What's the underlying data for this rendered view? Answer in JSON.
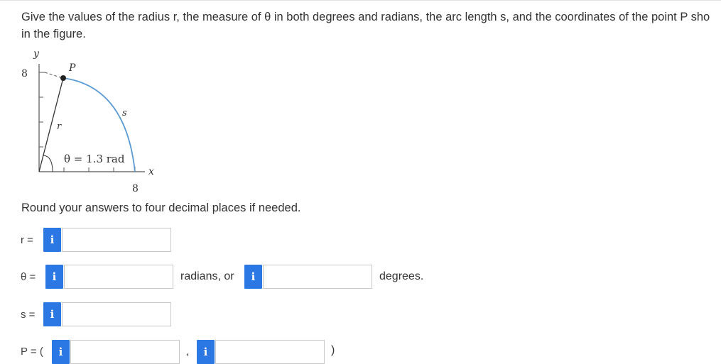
{
  "question": {
    "line1": "Give the values of the radius r, the measure of θ in both degrees and radians, the arc length s, and the coordinates of the point P sho",
    "line2": "in the figure."
  },
  "figure": {
    "y_axis_label": "y",
    "x_axis_label": "x",
    "y_tick_value": "8",
    "x_tick_value": "8",
    "point_label": "P",
    "radius_label": "r",
    "arc_label": "s",
    "angle_label": "θ = 1.3 rad"
  },
  "instruction": "Round your answers to four decimal places if needed.",
  "answers": {
    "r": {
      "label": "r =",
      "value": ""
    },
    "theta": {
      "label": "θ =",
      "radians_value": "",
      "radians_suffix": "radians, or",
      "degrees_value": "",
      "degrees_suffix": "degrees."
    },
    "s": {
      "label": "s =",
      "value": ""
    },
    "p": {
      "label": "P = (",
      "x_value": "",
      "separator": ",",
      "y_value": "",
      "close": ")"
    }
  },
  "info_icon_glyph": "i",
  "colors": {
    "info_button": "#2b78e4",
    "arc": "#5b9bd5",
    "point": "#222222"
  }
}
